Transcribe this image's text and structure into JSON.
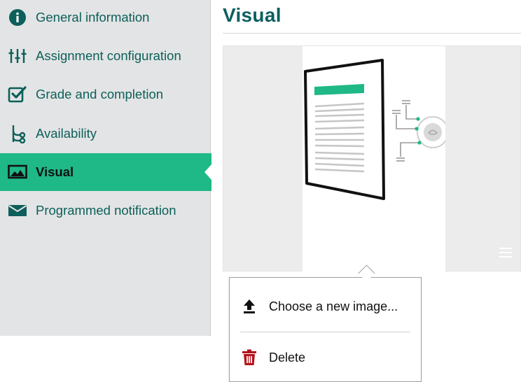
{
  "sidebar": {
    "items": [
      {
        "label": "General information",
        "icon": "info-icon"
      },
      {
        "label": "Assignment configuration",
        "icon": "sliders-icon"
      },
      {
        "label": "Grade and completion",
        "icon": "checkbox-icon"
      },
      {
        "label": "Availability",
        "icon": "branch-icon"
      },
      {
        "label": "Visual",
        "icon": "image-icon",
        "active": true
      },
      {
        "label": "Programmed notification",
        "icon": "envelope-icon"
      }
    ]
  },
  "main": {
    "title": "Visual"
  },
  "context_menu": {
    "items": [
      {
        "label": "Choose a new image...",
        "icon": "upload-icon"
      },
      {
        "label": "Delete",
        "icon": "trash-icon"
      }
    ]
  },
  "colors": {
    "accent": "#1fb887",
    "title": "#0d5f60",
    "nav_text": "#0c5f5a",
    "sidebar_bg": "#e3e4e5",
    "delete": "#b3121a"
  }
}
